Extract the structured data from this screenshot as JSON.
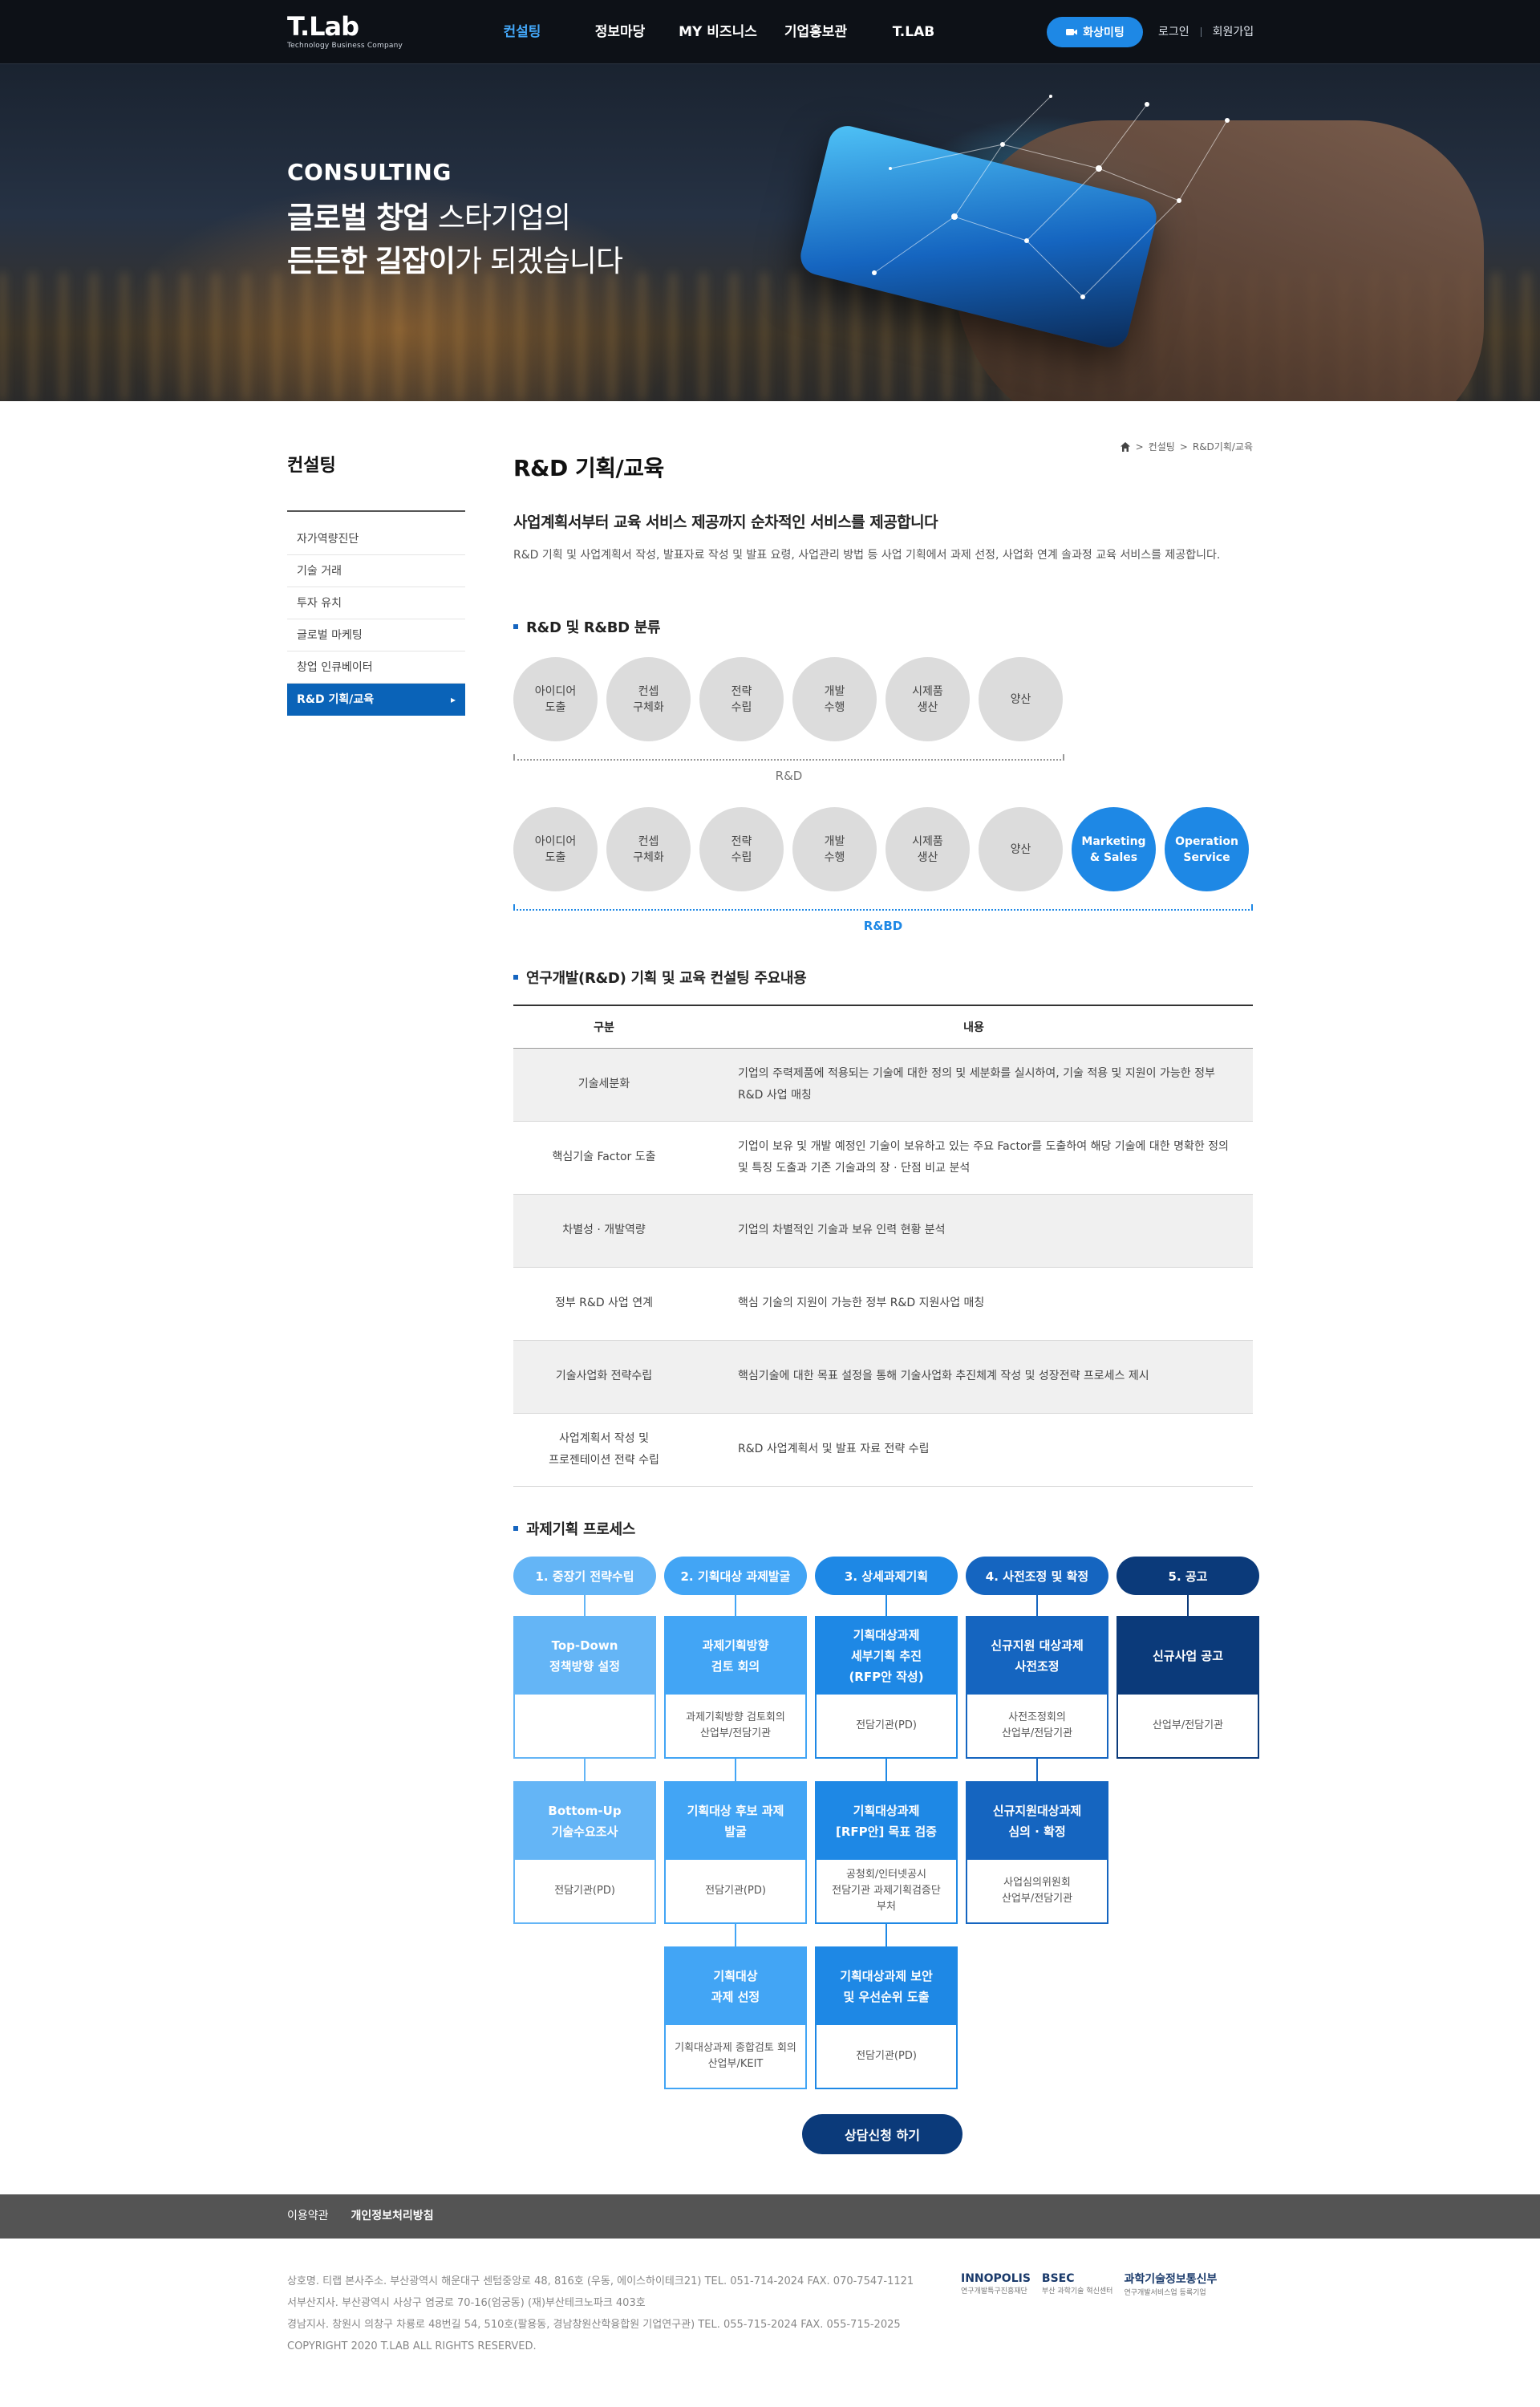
{
  "header": {
    "logo_main": "T.Lab",
    "logo_sub": "Technology Business Company",
    "nav": [
      "컨설팅",
      "정보마당",
      "MY 비즈니스",
      "기업홍보관",
      "T.LAB"
    ],
    "video_meeting_label": "화상미팅",
    "login_label": "로그인",
    "signup_label": "회원가입"
  },
  "hero": {
    "kicker": "CONSULTING",
    "line1_bold": "글로벌 창업",
    "line1_rest": " 스타기업의",
    "line2_bold1": "든든한",
    "line2_space": " ",
    "line2_bold2": "길잡이",
    "line2_rest": "가 되겠습니다"
  },
  "sidebar": {
    "title": "컨설팅",
    "items": [
      "자가역량진단",
      "기술 거래",
      "투자 유치",
      "글로벌 마케팅",
      "창업 인큐베이터",
      "R&D 기획/교육"
    ]
  },
  "breadcrumb": [
    "컨설팅",
    "R&D기획/교육"
  ],
  "page": {
    "title": "R&D 기획/교육",
    "lead": "사업계획서부터 교육 서비스 제공까지 순차적인 서비스를 제공합니다",
    "desc": "R&D 기획 및 사업계획서 작성, 발표자료 작성 및 발표 요령, 사업관리 방법 등 사업 기획에서 과제 선정, 사업화 연계 솔과정 교육 서비스를 제공합니다."
  },
  "classification": {
    "title": "R&D 및 R&BD 분류",
    "rd_circles": [
      "아이디어\n도출",
      "컨셉\n구체화",
      "전략\n수립",
      "개발\n수행",
      "시제품\n생산",
      "양산"
    ],
    "rd_label": "R&D",
    "rbd_circles": [
      "아이디어\n도출",
      "컨셉\n구체화",
      "전략\n수립",
      "개발\n수행",
      "시제품\n생산",
      "양산",
      "Marketing\n& Sales",
      "Operation\nService"
    ],
    "rbd_label": "R&BD"
  },
  "table": {
    "title": "연구개발(R&D) 기획 및 교육 컨설팅 주요내용",
    "headers": [
      "구분",
      "내용"
    ],
    "rows": [
      {
        "category": "기술세분화",
        "content": "기업의 주력제품에 적용되는 기술에 대한 정의 및 세분화를 실시하여, 기술 적용 및 지원이 가능한 정부 R&D 사업 매칭"
      },
      {
        "category": "핵심기술 Factor 도출",
        "content": "기업이 보유 및 개발 예정인 기술이 보유하고 있는 주요 Factor를 도출하여 해당 기술에 대한 명확한 정의 및 특징 도출과 기존 기술과의 장 · 단점 비교 분석"
      },
      {
        "category": "차별성 · 개발역량",
        "content": "기업의 차별적인 기술과 보유 인력 현황 분석"
      },
      {
        "category": "정부 R&D 사업 연계",
        "content": "핵심 기술의 지원이 가능한 정부 R&D 지원사업 매칭"
      },
      {
        "category": "기술사업화 전략수립",
        "content": "핵심기술에 대한 목표 설정을 통해 기술사업화 추진체계 작성 및 성장전략 프로세스 제시"
      },
      {
        "category": "사업계획서 작성 및\n프로젠테이션 전략 수립",
        "content": "R&D 사업계획서 및 발표 자료 전략 수립"
      }
    ]
  },
  "process": {
    "title": "과제기획 프로세스",
    "steps": [
      "1. 중장기 전략수립",
      "2. 기획대상 과제발굴",
      "3. 상세과제기획",
      "4. 사전조정 및 확정",
      "5. 공고"
    ],
    "step_colors": [
      "#64b5f6",
      "#42a5f5",
      "#1e88e5",
      "#1565c0",
      "#0b3a7a"
    ],
    "boxes": [
      {
        "title": "Top-Down\n정책방향 설정",
        "body": ""
      },
      {
        "title": "과제기획방향\n검토 회의",
        "body": "과제기획방향 검토회의\n산업부/전담기관"
      },
      {
        "title": "기획대상과제\n세부기획 추진\n(RFP안 작성)",
        "body": "전담기관(PD)"
      },
      {
        "title": "신규지원 대상과제\n사전조정",
        "body": "사전조정회의\n산업부/전담기관"
      },
      {
        "title": "신규사업 공고",
        "body": "산업부/전담기관"
      },
      {
        "title": "Bottom-Up\n기술수요조사",
        "body": "전담기관(PD)"
      },
      {
        "title": "기획대상 후보 과제\n발굴",
        "body": "전담기관(PD)"
      },
      {
        "title": "기획대상과제\n[RFP안] 목표 검증",
        "body": "공청회/인터넷공시\n전담기관 과제기획검증단\n부처"
      },
      {
        "title": "신규지원대상과제\n심의 · 확정",
        "body": "사업심의위원회\n산업부/전담기관"
      },
      {
        "title": "기획대상\n과제 선정",
        "body": "기획대상과제 종합검토 회의\n산업부/KEIT"
      },
      {
        "title": "기획대상과제 보안\n및 우선순위 도출",
        "body": "전담기관(PD)"
      }
    ],
    "cta_label": "상담신청 하기"
  },
  "footer": {
    "links": [
      "이용약관",
      "개인정보처리방침"
    ],
    "info": [
      "상호명. 티랩   본사주소. 부산광역시 해운대구 센텀중앙로 48, 816호 (우동, 에이스하이테크21)   TEL. 051-714-2024   FAX. 070-7547-1121",
      "서부산지사. 부산광역시 사상구 염궁로 70-16(엄궁동) (재)부산테크노파크 403호",
      "경남지사. 창원시 의창구 차룡로 48번길 54, 510호(팔용동, 경남창원산학융합원 기업연구관)   TEL. 055-715-2024   FAX. 055-715-2025",
      "COPYRIGHT 2020 T.LAB ALL RIGHTS RESERVED."
    ],
    "logos": [
      {
        "name": "INNOPOLIS",
        "sub": "연구개발특구진흥재단"
      },
      {
        "name": "BSEC",
        "sub": "부산 과학기술 혁신센터"
      },
      {
        "name": "과학기술정보통신부",
        "sub": "연구개발서비스업 등록기업"
      }
    ]
  }
}
